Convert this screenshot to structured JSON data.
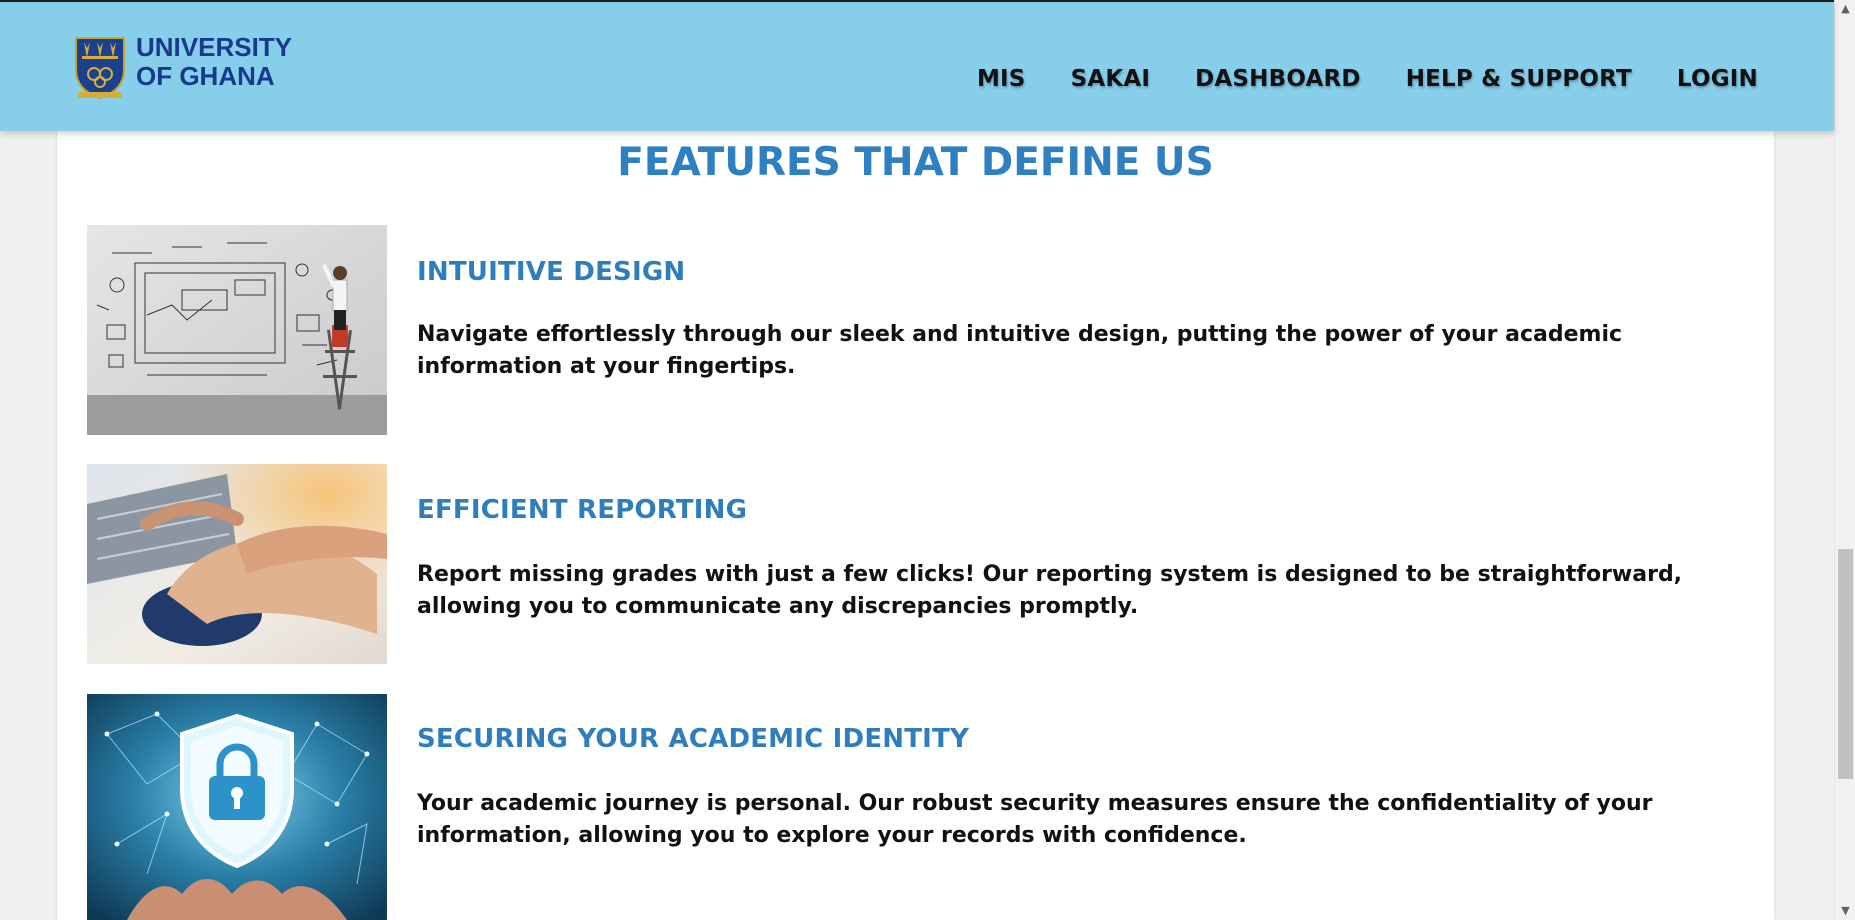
{
  "header": {
    "logo_line1": "UNIVERSITY",
    "logo_line2": "OF GHANA",
    "nav": [
      "MIS",
      "SAKAI",
      "DASHBOARD",
      "HELP & SUPPORT",
      "LOGIN"
    ],
    "background": "#87ceeb"
  },
  "main": {
    "title": "FEATURES THAT DEFINE US",
    "features": [
      {
        "heading": "INTUITIVE DESIGN",
        "text": "Navigate effortlessly through our sleek and intuitive design, putting the power of your academic information at your fingertips.",
        "image": "whiteboard-sketch-image"
      },
      {
        "heading": "EFFICIENT REPORTING",
        "text": "Report missing grades with just a few clicks! Our reporting system is designed to be straightforward, allowing you to communicate any discrepancies promptly.",
        "image": "hand-on-mouse-image"
      },
      {
        "heading": "SECURING YOUR ACADEMIC IDENTITY",
        "text": "Your academic journey is personal. Our robust security measures ensure the confidentiality of your information, allowing you to explore your records with confidence.",
        "image": "security-shield-lock-image"
      }
    ]
  },
  "colors": {
    "accent": "#2e7dbd",
    "logo_blue": "#173a8c",
    "text": "#111111"
  }
}
